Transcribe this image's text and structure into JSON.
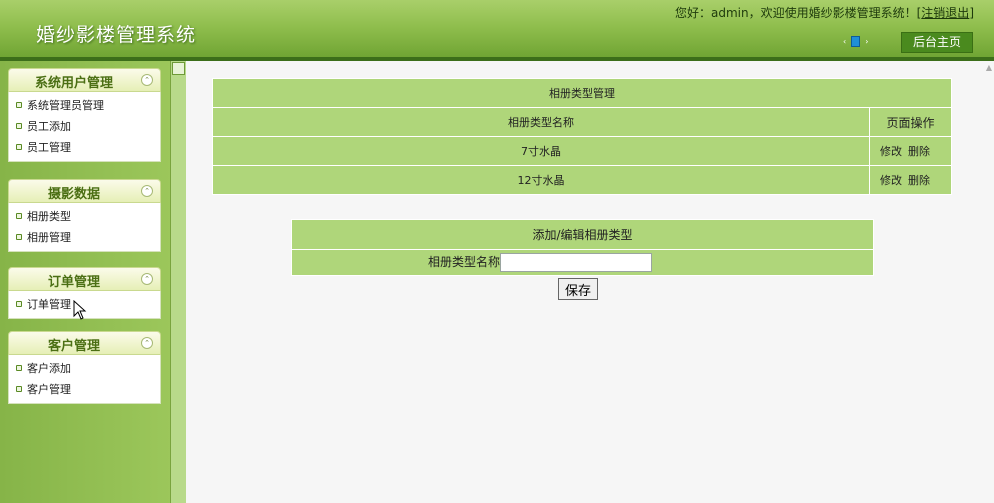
{
  "header": {
    "logo": "婚纱影楼管理系统",
    "welcome_prefix": "您好：admin，欢迎使用婚纱影楼管理系统！[",
    "logout": "注销退出",
    "welcome_suffix": "]",
    "nav_prev_glyph": "‹",
    "nav_next_glyph": "›",
    "home_button": "后台主页"
  },
  "sidebar": {
    "groups": [
      {
        "title": "系统用户管理",
        "items": [
          {
            "label": "系统管理员管理"
          },
          {
            "label": "员工添加"
          },
          {
            "label": "员工管理"
          }
        ]
      },
      {
        "title": "摄影数据",
        "items": [
          {
            "label": "相册类型"
          },
          {
            "label": "相册管理"
          }
        ]
      },
      {
        "title": "订单管理",
        "items": [
          {
            "label": "订单管理"
          }
        ]
      },
      {
        "title": "客户管理",
        "items": [
          {
            "label": "客户添加"
          },
          {
            "label": "客户管理"
          }
        ]
      }
    ],
    "toggle_glyph": "⌃"
  },
  "main": {
    "list_title": "相册类型管理",
    "col_name": "相册类型名称",
    "col_ops": "页面操作",
    "rows": [
      {
        "name": "7寸水晶",
        "edit": "修改",
        "delete": "删除"
      },
      {
        "name": "12寸水晶",
        "edit": "修改",
        "delete": "删除"
      }
    ],
    "form_title": "添加/编辑相册类型",
    "form_label": "相册类型名称",
    "form_value": "",
    "save_button": "保存"
  },
  "colors": {
    "header_green": "#8fbe4d",
    "table_green": "#afd67a",
    "menu_title": "#4b6f14"
  }
}
